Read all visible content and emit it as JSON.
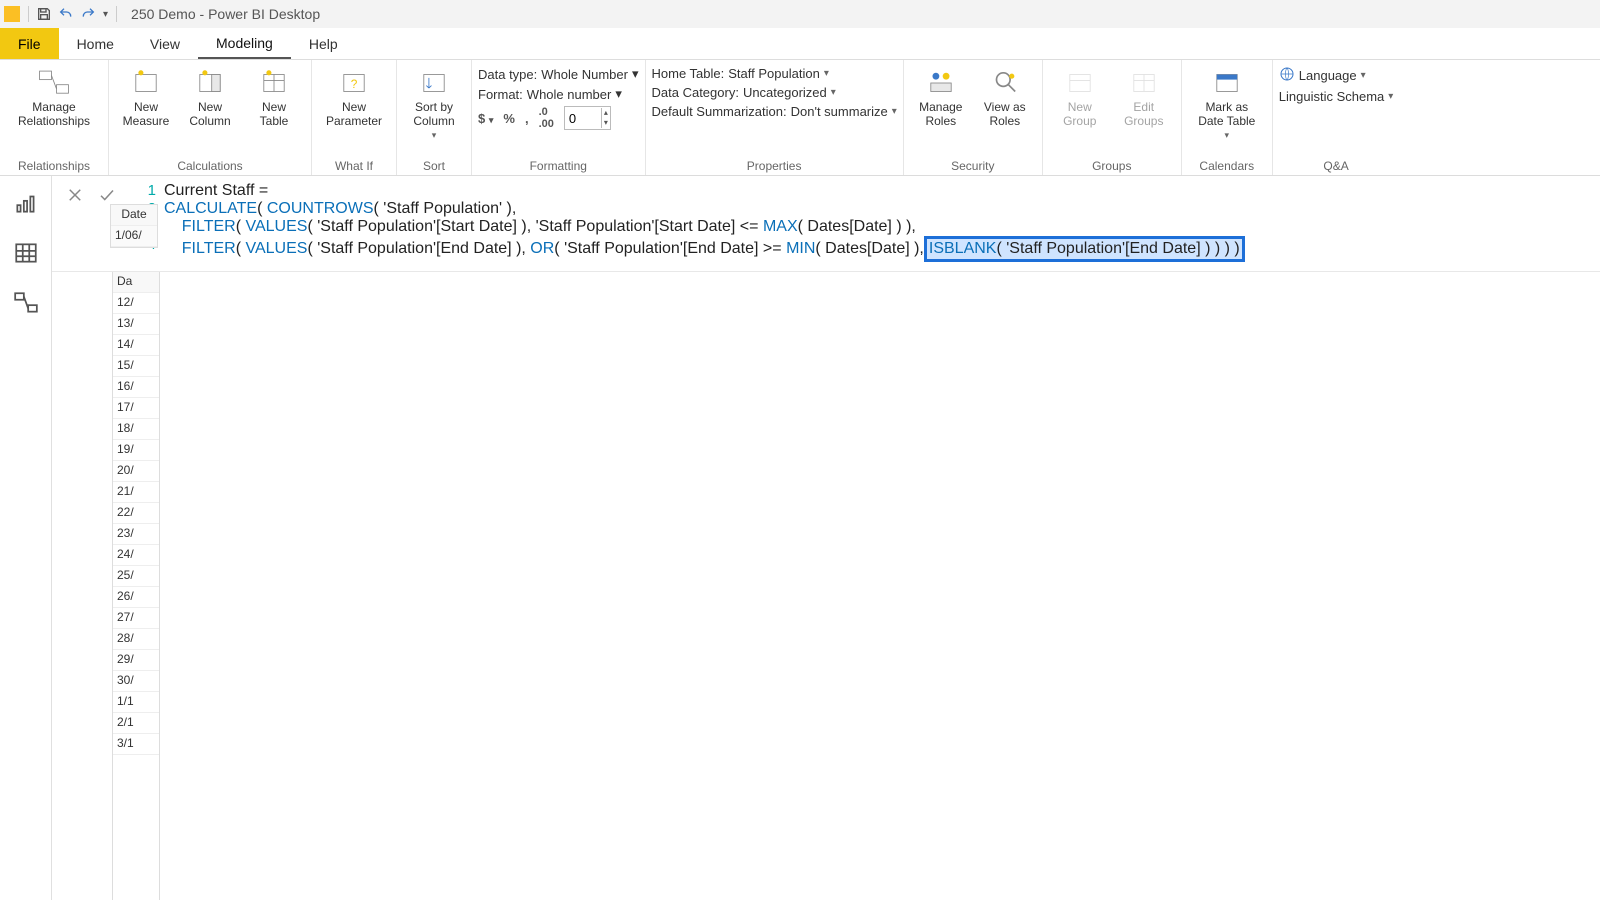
{
  "titlebar": {
    "app": "250 Demo - Power BI Desktop"
  },
  "tabs": {
    "file": "File",
    "home": "Home",
    "view": "View",
    "modeling": "Modeling",
    "help": "Help"
  },
  "ribbon": {
    "relationships": {
      "manage": "Manage\nRelationships",
      "group": "Relationships"
    },
    "calc": {
      "measure": "New\nMeasure",
      "column": "New\nColumn",
      "table": "New\nTable",
      "group": "Calculations"
    },
    "whatif": {
      "param": "New\nParameter",
      "group": "What If"
    },
    "sort": {
      "sortby": "Sort by\nColumn",
      "group": "Sort"
    },
    "formatting": {
      "datatype_label": "Data type:",
      "datatype_value": "Whole Number",
      "format_label": "Format:",
      "format_value": "Whole number",
      "decimals": "0",
      "group": "Formatting"
    },
    "properties": {
      "hometable_label": "Home Table:",
      "hometable_value": "Staff Population",
      "datacat_label": "Data Category:",
      "datacat_value": "Uncategorized",
      "summ_label": "Default Summarization:",
      "summ_value": "Don't summarize",
      "group": "Properties"
    },
    "security": {
      "manage": "Manage\nRoles",
      "viewas": "View as\nRoles",
      "group": "Security"
    },
    "groups": {
      "newg": "New\nGroup",
      "editg": "Edit\nGroups",
      "group": "Groups"
    },
    "calendars": {
      "mark": "Mark as\nDate Table",
      "group": "Calendars"
    },
    "qa": {
      "lang": "Language",
      "schema": "Linguistic Schema",
      "group": "Q&A"
    }
  },
  "formula": {
    "line1": "Current Staff =",
    "l2_calc": "CALCULATE",
    "l2_countrows": "COUNTROWS",
    "l2_table": "'Staff Population'",
    "l3_filter": "FILTER",
    "l3_values": "VALUES",
    "l3_col": "'Staff Population'[Start Date]",
    "l3_op": "<=",
    "l3_max": "MAX",
    "l3_dates": "Dates[Date]",
    "l4_filter": "FILTER",
    "l4_values": "VALUES",
    "l4_col": "'Staff Population'[End Date]",
    "l4_or": "OR",
    "l4_op": ">=",
    "l4_min": "MIN",
    "l4_dates": "Dates[Date]",
    "l4_isblank": "ISBLANK",
    "l4_hl_rest": "( 'Staff Population'[End Date] ) ) ) )"
  },
  "grid": {
    "date_header": "Date",
    "date_value": "1/06/",
    "col2": "Da",
    "rows": [
      "12/",
      "13/",
      "14/",
      "15/",
      "16/",
      "17/",
      "18/",
      "19/",
      "20/",
      "21/",
      "22/",
      "23/",
      "24/",
      "25/",
      "26/",
      "27/",
      "28/",
      "29/",
      "30/",
      "1/1",
      "2/1",
      "3/1"
    ]
  }
}
